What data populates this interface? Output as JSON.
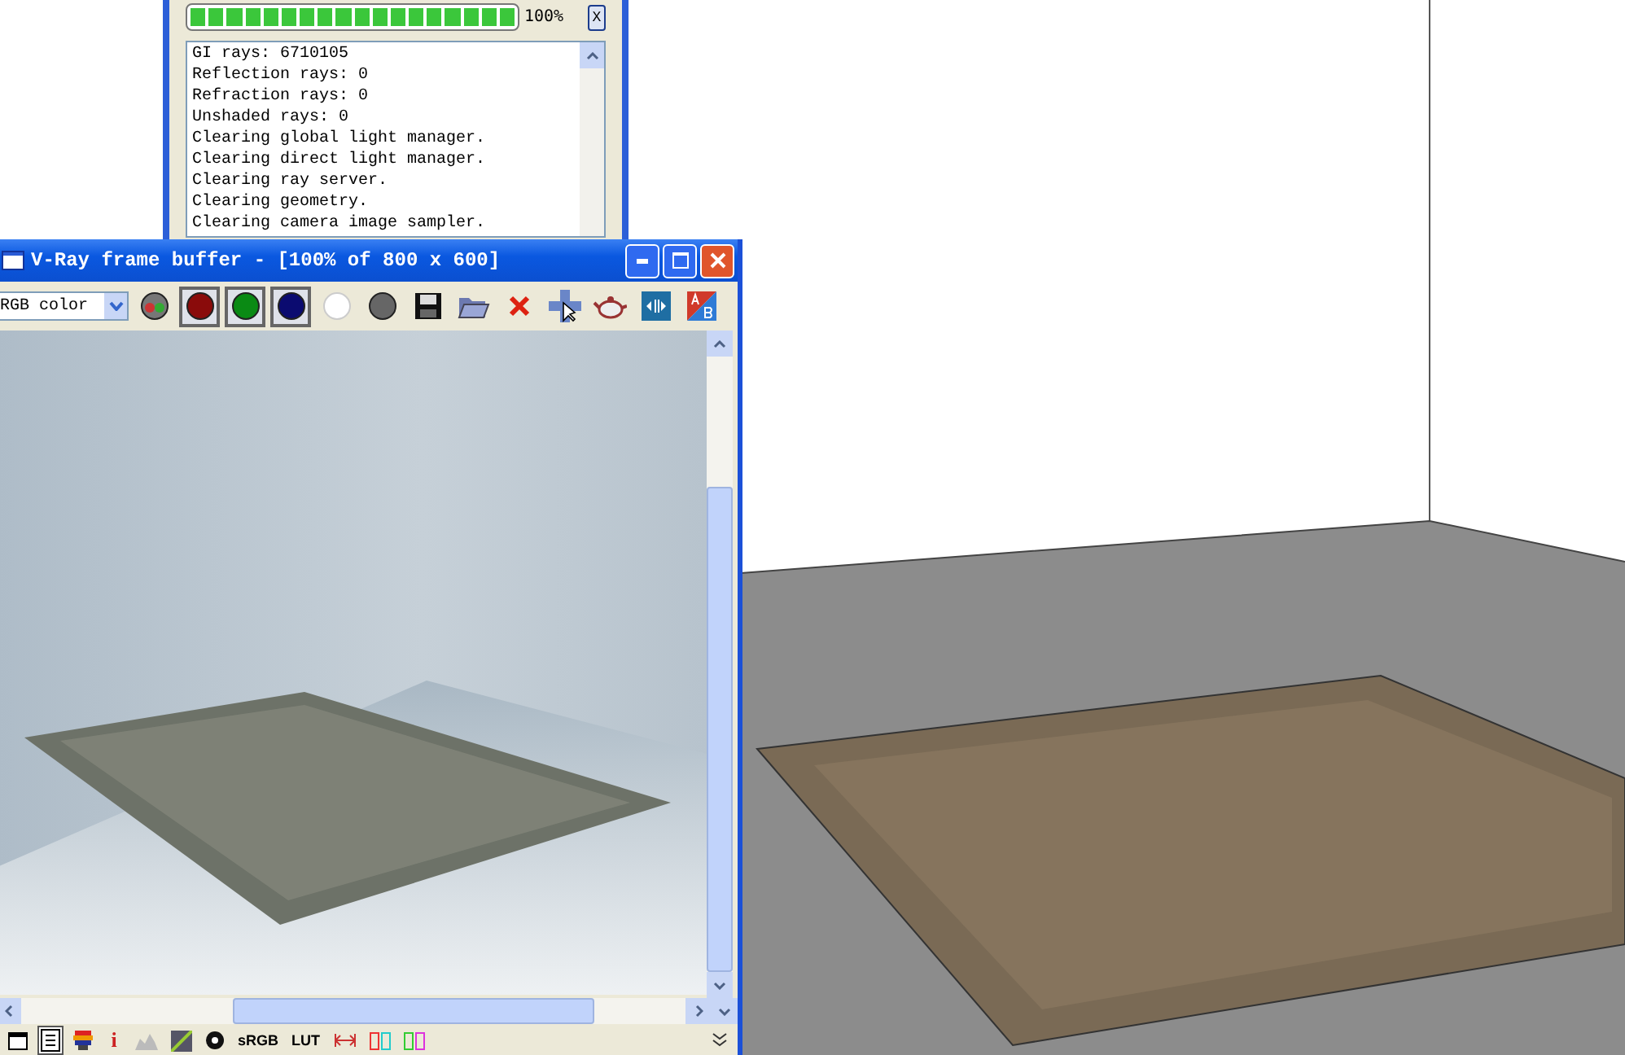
{
  "render_progress": {
    "level": 1.0,
    "percent": "100%",
    "close_label": "X",
    "log": [
      "GI rays: 6710105",
      "Reflection rays: 0",
      "Refraction rays: 0",
      "Unshaded rays: 0",
      "Clearing global light manager.",
      "Clearing direct light manager.",
      "Clearing ray server.",
      "Clearing geometry.",
      "Clearing camera image sampler."
    ]
  },
  "frame_buffer": {
    "title": "V-Ray frame buffer - [100% of 800 x 600]",
    "channel": "RGB color",
    "toolbar": [
      {
        "kind": "icon",
        "pressed": false
      },
      {
        "kind": "icon",
        "pressed": true
      },
      {
        "kind": "icon",
        "pressed": true
      },
      {
        "kind": "icon",
        "pressed": true
      },
      {
        "kind": "icon",
        "pressed": false
      },
      {
        "kind": "icon",
        "pressed": false
      },
      {
        "kind": "icon",
        "pressed": false
      },
      {
        "kind": "icon",
        "pressed": false
      },
      {
        "kind": "icon",
        "pressed": false
      },
      {
        "kind": "icon",
        "pressed": false
      },
      {
        "kind": "icon",
        "pressed": false
      },
      {
        "kind": "icon",
        "pressed": false
      },
      {
        "kind": "icon",
        "pressed": false
      }
    ],
    "bottom_toolbar": [
      {
        "kind": "icon",
        "pressed": false
      },
      {
        "kind": "icon",
        "pressed": true
      },
      {
        "kind": "icon",
        "pressed": false
      },
      {
        "kind": "text",
        "label": "i",
        "pressed": false
      },
      {
        "kind": "icon",
        "pressed": false
      },
      {
        "kind": "icon",
        "pressed": false
      },
      {
        "kind": "icon",
        "pressed": false
      },
      {
        "kind": "text",
        "label": "sRGB",
        "pressed": false
      },
      {
        "kind": "text",
        "label": "LUT",
        "pressed": false
      },
      {
        "kind": "icon",
        "pressed": false
      },
      {
        "kind": "icon",
        "pressed": false
      },
      {
        "kind": "icon",
        "pressed": false
      }
    ]
  }
}
